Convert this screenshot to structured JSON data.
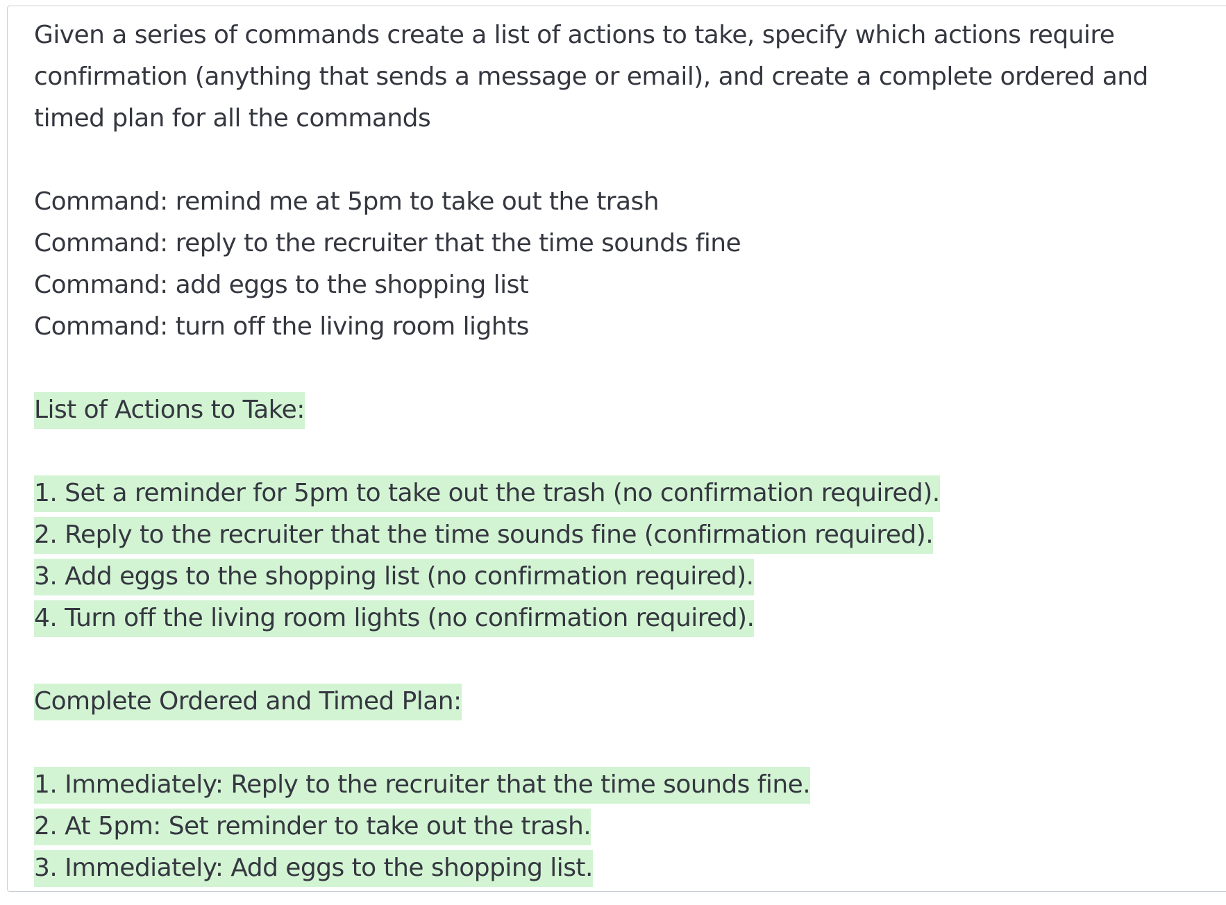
{
  "prompt": {
    "instruction_lines": [
      "Given a series of commands create a list of actions to take, specify which actions require",
      "confirmation (anything that sends a message or email), and create a complete ordered and",
      "timed plan for all the commands"
    ],
    "commands": [
      "Command: remind me at 5pm to take out the trash",
      "Command: reply to the recruiter that the time sounds fine",
      "Command: add eggs to the shopping list",
      "Command: turn off the living room lights"
    ]
  },
  "completion": {
    "actions_heading": "List of Actions to Take:",
    "actions": [
      "1. Set a reminder for 5pm to take out the trash (no confirmation required).",
      "2. Reply to the recruiter that the time sounds fine (confirmation required).",
      "3. Add eggs to the shopping list (no confirmation required).",
      "4. Turn off the living room lights (no confirmation required)."
    ],
    "plan_heading": "Complete Ordered and Timed Plan:",
    "plan": [
      "1. Immediately: Reply to the recruiter that the time sounds fine.",
      "2. At 5pm: Set reminder to take out the trash.",
      "3. Immediately: Add eggs to the shopping list."
    ]
  },
  "colors": {
    "text": "#353740",
    "highlight": "#d2f4d3",
    "border": "#c9cdd4",
    "background": "#ffffff"
  }
}
